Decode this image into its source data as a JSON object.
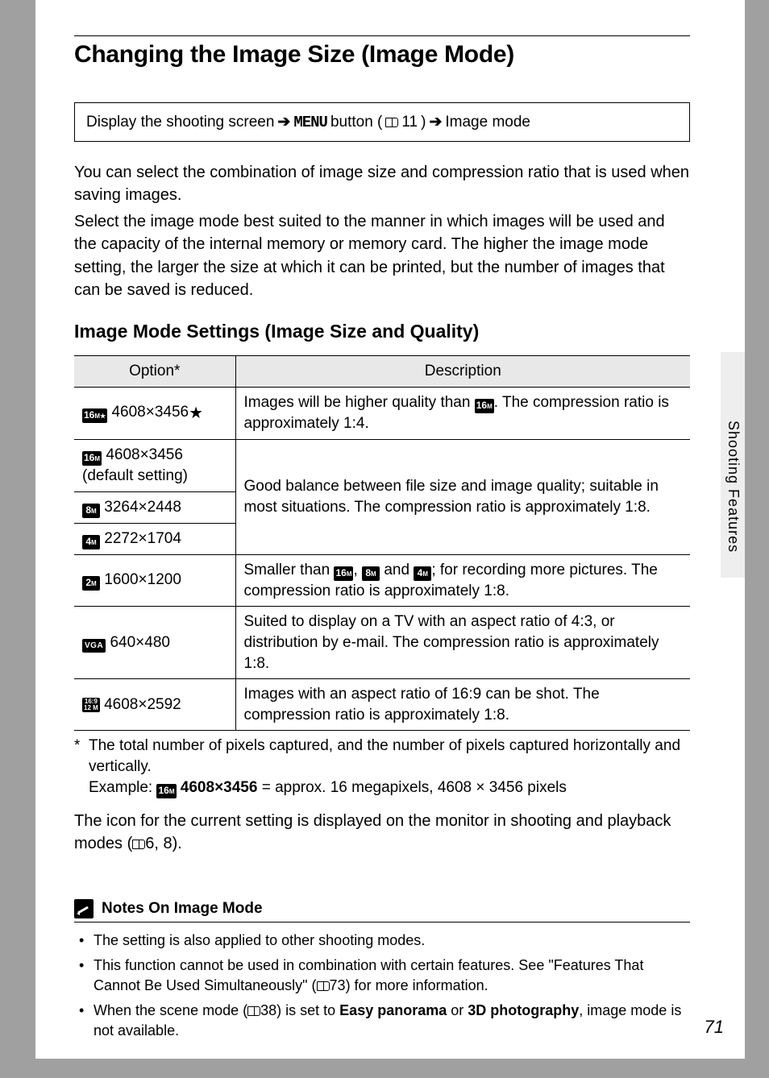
{
  "side_tab": "Shooting Features",
  "title": "Changing the Image Size (Image Mode)",
  "nav": {
    "part1": "Display the shooting screen",
    "menu_word": "MENU",
    "part2": " button (",
    "ref": "11",
    "part3": ")",
    "part4": " Image mode"
  },
  "intro1": "You can select the combination of image size and compression ratio that is used when saving images.",
  "intro2": "Select the image mode best suited to the manner in which images will be used and the capacity of the internal memory or memory card. The higher the image mode setting, the larger the size at which it can be printed, but the number of images that can be saved is reduced.",
  "subheading": "Image Mode Settings (Image Size and Quality)",
  "table": {
    "header_option": "Option*",
    "header_desc": "Description",
    "rows": [
      {
        "icon_top": "16",
        "icon_sub": "M",
        "icon_extra": "star",
        "dims": "4608×3456",
        "suffix": "★",
        "desc_pre": "Images will be higher quality than ",
        "desc_icon_top": "16",
        "desc_icon_sub": "M",
        "desc_post": ". The compression ratio is approximately 1:4."
      },
      {
        "icon_top": "16",
        "icon_sub": "M",
        "dims": "4608×3456",
        "suffix_line2": "(default setting)"
      },
      {
        "icon_top": "8",
        "icon_sub": "M",
        "dims": "3264×2448"
      },
      {
        "icon_top": "4",
        "icon_sub": "M",
        "dims": "2272×1704"
      },
      {
        "icon_top": "2",
        "icon_sub": "M",
        "dims": "1600×1200",
        "desc_pre": "Smaller than  ",
        "desc_icons": [
          {
            "t": "16",
            "s": "M"
          },
          {
            "sep": ", "
          },
          {
            "t": "8",
            "s": "M"
          },
          {
            "sep": " and "
          },
          {
            "t": "4",
            "s": "M"
          }
        ],
        "desc_post": "; for recording more pictures. The compression ratio is approximately 1:8."
      },
      {
        "icon_vga": "VGA",
        "dims": "640×480",
        "desc": "Suited to display on a TV with an aspect ratio of 4:3, or distribution by e-mail. The compression ratio is approximately 1:8."
      },
      {
        "icon_ratio_top": "16:9",
        "icon_ratio_bot": "12 M",
        "dims": "4608×2592",
        "desc": "Images with an aspect ratio of 16:9 can be shot. The compression ratio is approximately 1:8."
      }
    ],
    "merged_desc": "Good balance between file size and image quality; suitable in most situations. The compression ratio is approximately 1:8."
  },
  "footnote_star": "*",
  "footnote": "The total number of pixels captured, and the number of pixels captured horizontally and vertically.",
  "footnote_example_label": "Example: ",
  "footnote_example_icon_top": "16",
  "footnote_example_icon_sub": "M",
  "footnote_example_bold": "4608×3456",
  "footnote_example_rest": " = approx. 16 megapixels, 4608 × 3456 pixels",
  "after_table_1": "The icon for the current setting is displayed on the monitor in shooting and playback modes (",
  "after_table_ref": "6, 8",
  "after_table_2": ").",
  "notes_heading": "Notes On Image Mode",
  "notes": [
    {
      "text": "The setting is also applied to other shooting modes."
    },
    {
      "pre": "This function cannot be used in combination with certain features. See \"Features That Cannot Be Used Simultaneously\" (",
      "ref": "73",
      "post": ") for more information."
    },
    {
      "pre": "When the scene mode (",
      "ref": "38",
      "post1": ") is set to ",
      "bold1": "Easy panorama",
      "mid": " or ",
      "bold2": "3D photography",
      "post2": ", image mode is not available."
    }
  ],
  "page_number": "71"
}
